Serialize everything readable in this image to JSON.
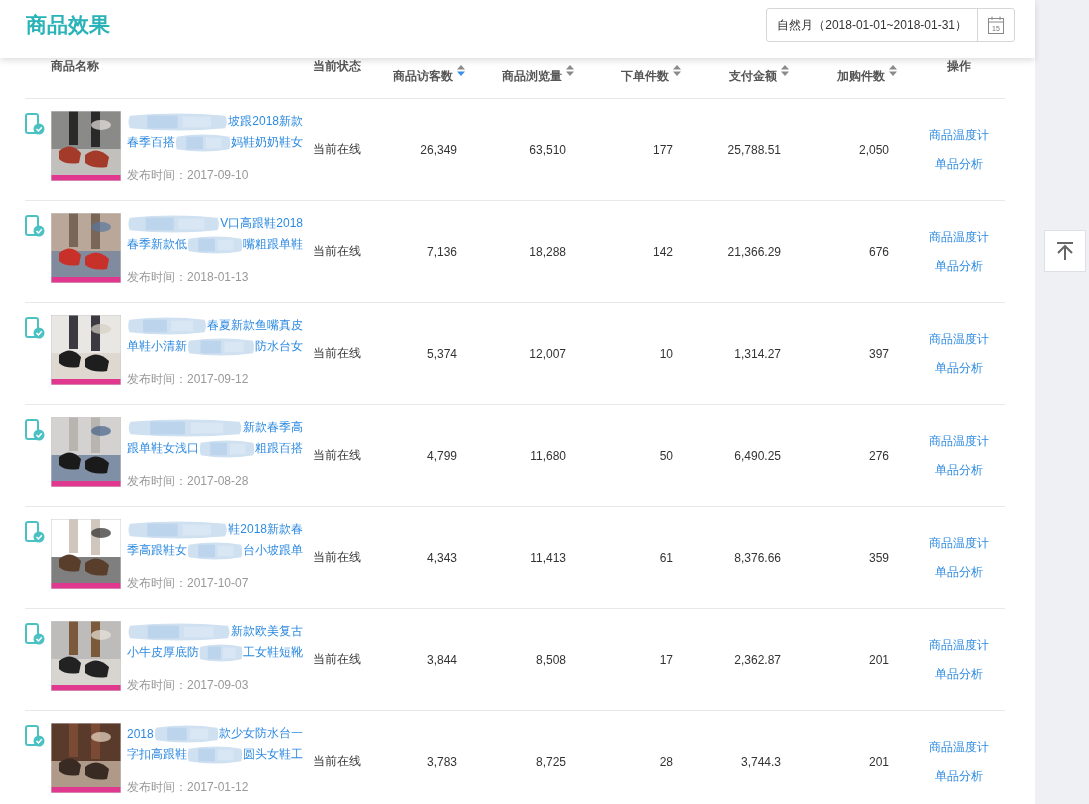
{
  "header": {
    "title": "商品效果",
    "date_range": "自然月（2018-01-01~2018-01-31）",
    "calendar_day": "15"
  },
  "columns": [
    {
      "label": "商品名称"
    },
    {
      "label": "当前状态"
    },
    {
      "label": "商品访客数",
      "sorted": true
    },
    {
      "label": "商品浏览量",
      "sorted": false
    },
    {
      "label": "下单件数",
      "sorted": false
    },
    {
      "label": "支付金额",
      "sorted": false
    },
    {
      "label": "加购件数",
      "sorted": false
    },
    {
      "label": "操作"
    }
  ],
  "rows": [
    {
      "title_lines": [
        {
          "after": "坡跟2018新款"
        },
        {
          "before": "春季百搭",
          "after": "妈鞋奶奶鞋女"
        }
      ],
      "published": "发布时间：2017-09-10",
      "status": "当前在线",
      "visitors": "26,349",
      "views": "63,510",
      "orders": "177",
      "payment": "25,788.51",
      "cart": "2,050",
      "actions": [
        "商品温度计",
        "单品分析"
      ]
    },
    {
      "title_lines": [
        {
          "after": "V口高跟鞋2018"
        },
        {
          "before": "春季新款低",
          "after": "嘴粗跟单鞋"
        }
      ],
      "published": "发布时间：2018-01-13",
      "status": "当前在线",
      "visitors": "7,136",
      "views": "18,288",
      "orders": "142",
      "payment": "21,366.29",
      "cart": "676",
      "actions": [
        "商品温度计",
        "单品分析"
      ]
    },
    {
      "title_lines": [
        {
          "after": "春夏新款鱼嘴真皮"
        },
        {
          "before": "单鞋小清新",
          "after": "防水台女"
        }
      ],
      "published": "发布时间：2017-09-12",
      "status": "当前在线",
      "visitors": "5,374",
      "views": "12,007",
      "orders": "10",
      "payment": "1,314.27",
      "cart": "397",
      "actions": [
        "商品温度计",
        "单品分析"
      ]
    },
    {
      "title_lines": [
        {
          "after": "新款春季高"
        },
        {
          "before": "跟单鞋女浅口",
          "after": "粗跟百搭"
        }
      ],
      "published": "发布时间：2017-08-28",
      "status": "当前在线",
      "visitors": "4,799",
      "views": "11,680",
      "orders": "50",
      "payment": "6,490.25",
      "cart": "276",
      "actions": [
        "商品温度计",
        "单品分析"
      ]
    },
    {
      "title_lines": [
        {
          "after": "鞋2018新款春"
        },
        {
          "before": "季高跟鞋女",
          "after": "台小坡跟单"
        }
      ],
      "published": "发布时间：2017-10-07",
      "status": "当前在线",
      "visitors": "4,343",
      "views": "11,413",
      "orders": "61",
      "payment": "8,376.66",
      "cart": "359",
      "actions": [
        "商品温度计",
        "单品分析"
      ]
    },
    {
      "title_lines": [
        {
          "after": "新款欧美复古"
        },
        {
          "before": "小牛皮厚底防",
          "after": "工女鞋短靴"
        }
      ],
      "published": "发布时间：2017-09-03",
      "status": "当前在线",
      "visitors": "3,844",
      "views": "8,508",
      "orders": "17",
      "payment": "2,362.87",
      "cart": "201",
      "actions": [
        "商品温度计",
        "单品分析"
      ]
    },
    {
      "title_lines": [
        {
          "before": "2018",
          "after": "款少女防水台一"
        },
        {
          "before": "字扣高跟鞋",
          "after": "圆头女鞋工"
        }
      ],
      "published": "发布时间：2017-01-12",
      "status": "当前在线",
      "visitors": "3,783",
      "views": "8,725",
      "orders": "28",
      "payment": "3,744.3",
      "cart": "201",
      "actions": [
        "商品温度计",
        "单品分析"
      ]
    }
  ]
}
